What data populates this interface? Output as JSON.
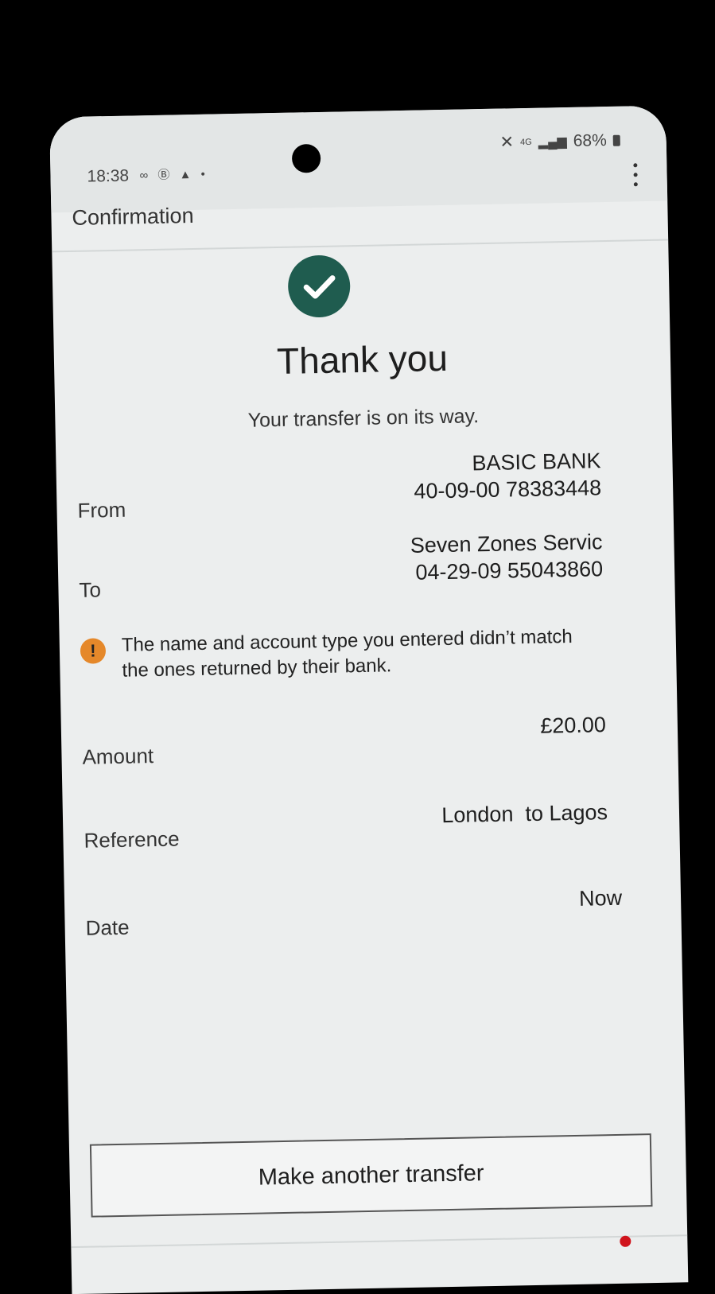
{
  "status_bar": {
    "time": "18:38",
    "battery": "68%",
    "network": "4G"
  },
  "header": {
    "title": "Confirmation",
    "menu_icon": "more-vert-icon"
  },
  "confirmation": {
    "icon": "check-circle-icon",
    "heading": "Thank you",
    "subtitle": "Your transfer is on its way."
  },
  "details": {
    "from": {
      "label": "From",
      "bank": "BASIC BANK",
      "account": "40-09-00 78383448"
    },
    "to": {
      "label": "To",
      "name": "Seven Zones Servic",
      "account": "04-29-09 55043860"
    },
    "warning": {
      "icon": "warning-icon",
      "text": "The name and account type you entered didn’t match the ones returned by their bank."
    },
    "amount": {
      "label": "Amount",
      "value": "£20.00"
    },
    "reference": {
      "label": "Reference",
      "value": "London  to Lagos"
    },
    "date": {
      "label": "Date",
      "value": "Now"
    }
  },
  "actions": {
    "another_transfer": "Make another transfer"
  },
  "colors": {
    "accent_green": "#1f5c4f",
    "warning_orange": "#e5882a",
    "notification_red": "#d0141c"
  }
}
